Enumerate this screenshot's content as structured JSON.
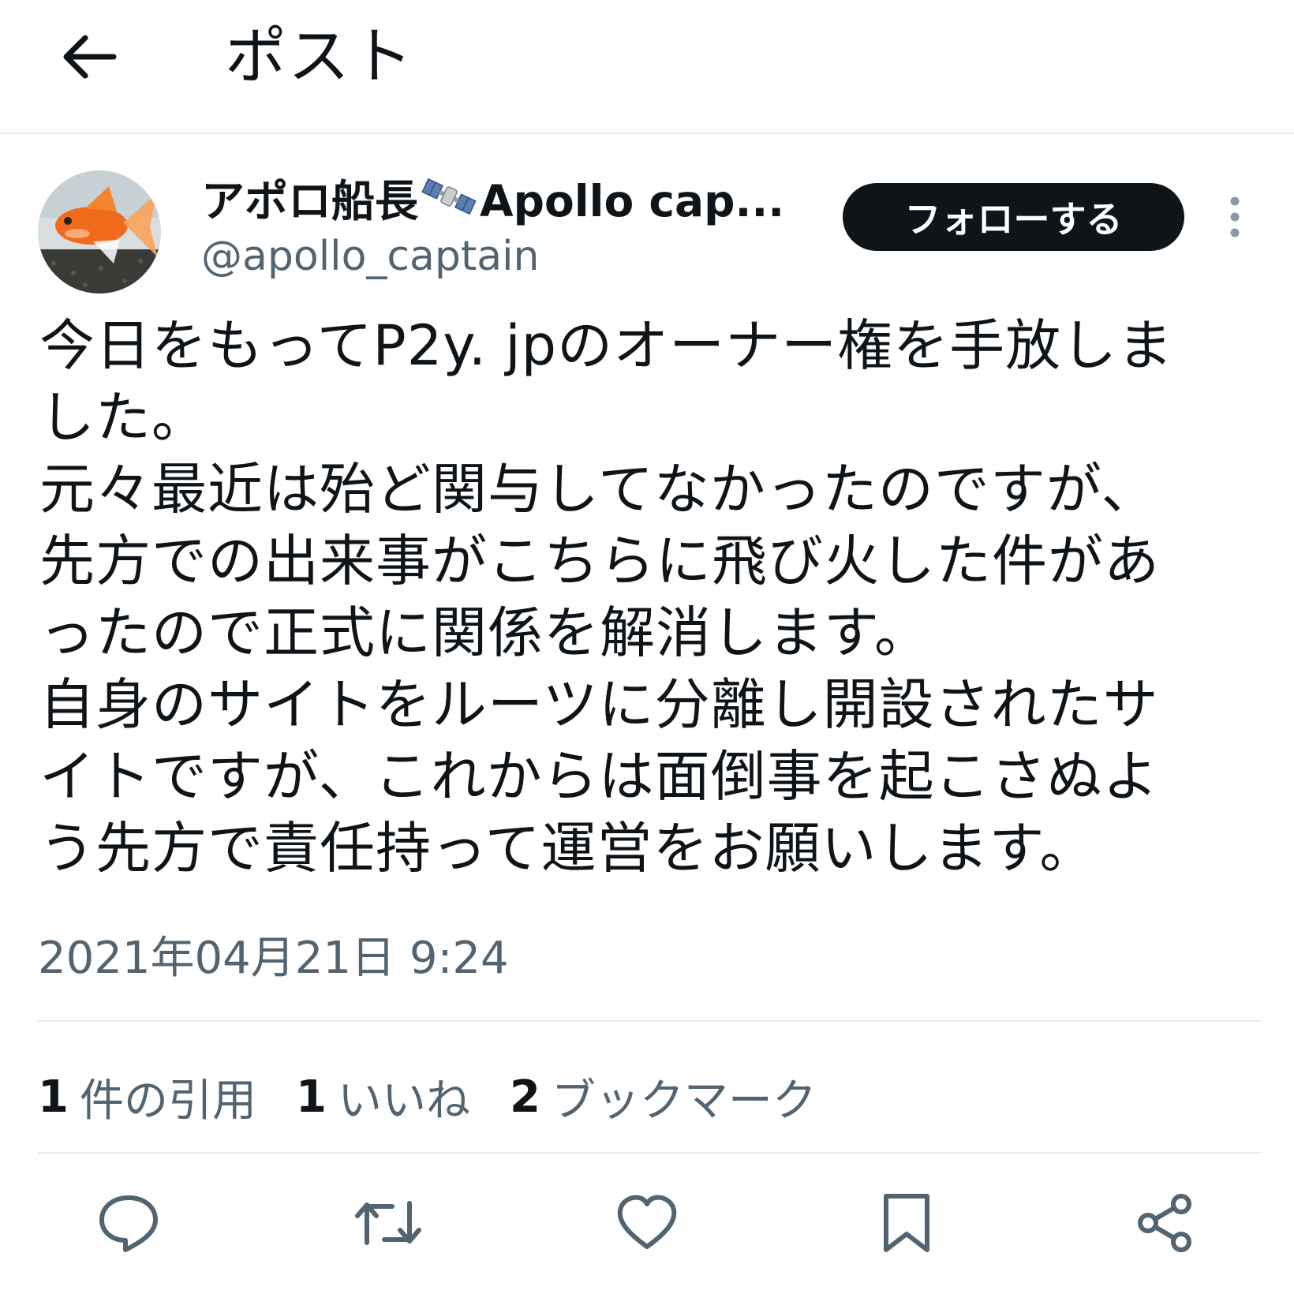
{
  "header": {
    "title": "ポスト",
    "back_icon": "arrow-left-icon"
  },
  "author": {
    "display_name_jp": "アポロ船長",
    "display_name_en": "Apollo cap...",
    "name_emoji": "satellite-icon",
    "handle": "@apollo_captain",
    "avatar": "goldfish-avatar"
  },
  "follow_button": {
    "label": "フォローする"
  },
  "post": {
    "lines": [
      "今日をもってP2y. jpのオーナー権を手放しま",
      "した。",
      "元々最近は殆ど関与してなかったのですが、",
      "先方での出来事がこちらに飛び火した件があ",
      "ったので正式に関係を解消します。",
      "自身のサイトをルーツに分離し開設されたサ",
      "イトですが、これからは面倒事を起こさぬよ",
      "う先方で責任持って運営をお願いします。"
    ],
    "timestamp": "2021年04月21日 9:24"
  },
  "stats": {
    "quotes_count": "1",
    "quotes_label": "件の引用",
    "likes_count": "1",
    "likes_label": "いいね",
    "bookmarks_count": "2",
    "bookmarks_label": "ブックマーク"
  },
  "colors": {
    "text_primary": "#0f1419",
    "text_secondary": "#536471",
    "divider": "#e6e9ec",
    "follow_bg": "#0f1419"
  },
  "actions": [
    "reply-icon",
    "repost-icon",
    "like-icon",
    "bookmark-icon",
    "share-icon"
  ]
}
